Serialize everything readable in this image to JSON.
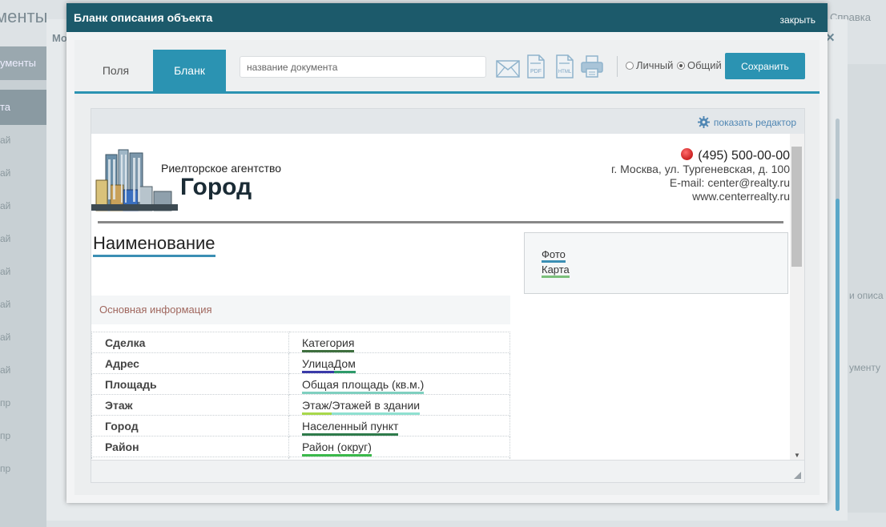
{
  "background": {
    "title_fragment": "менты",
    "help_fragment": "Справка",
    "outer_label_fragment": "Мо",
    "sidebar": [
      "ументы",
      "та",
      "ай",
      "ай",
      "ай",
      "ай",
      "ай",
      "ай",
      "ай",
      "ай",
      "пр",
      "пр",
      "пр"
    ],
    "right_fragments": [
      "и описа",
      "ументу"
    ]
  },
  "modal": {
    "title": "Бланк описания объекта",
    "close_label": "закрыть"
  },
  "toolbar": {
    "tabs": [
      {
        "label": "Поля",
        "active": false
      },
      {
        "label": "Бланк",
        "active": true
      }
    ],
    "doc_name_placeholder": "название документа",
    "icons": [
      "envelope-icon",
      "pdf-icon",
      "html-icon",
      "printer-icon"
    ],
    "icon_labels": {
      "pdf": "PDF",
      "html": "HTML"
    },
    "visibility": [
      {
        "label": "Личный",
        "checked": false
      },
      {
        "label": "Общий",
        "checked": true
      }
    ],
    "save_label": "Сохранить"
  },
  "document": {
    "editor_link": "показать редактор",
    "agency_small": "Риелторское агентство",
    "agency_big": "Город",
    "contacts": {
      "phone": "(495) 500-00-00",
      "address": "г. Москва, ул. Тургеневская, д. 100",
      "email": "E-mail: center@realty.ru",
      "site": "www.centerrealty.ru"
    },
    "name_title": "Наименование",
    "section_title": "Основная информация",
    "media_links": [
      "Фото",
      "Карта"
    ],
    "properties": [
      {
        "key": "Сделка",
        "values": [
          "Категория"
        ]
      },
      {
        "key": "Адрес",
        "values": [
          "Улица",
          "Дом"
        ]
      },
      {
        "key": "Площадь",
        "values": [
          "Общая площадь (кв.м.)"
        ]
      },
      {
        "key": "Этаж",
        "values": [
          "Этаж/",
          "Этажей в здании"
        ]
      },
      {
        "key": "Город",
        "values": [
          "Населенный пункт"
        ]
      },
      {
        "key": "Район",
        "values": [
          "Район (округ)"
        ]
      }
    ]
  },
  "colors": {
    "header": "#1c5a6b",
    "accent": "#2b93b2",
    "section_text": "#a0675e"
  }
}
